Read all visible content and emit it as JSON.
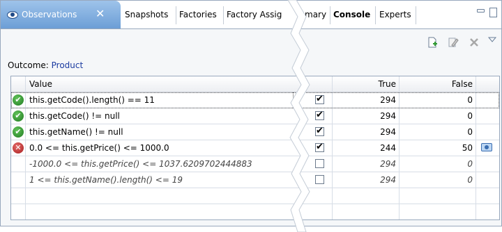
{
  "tabs": {
    "active": "Observations",
    "close": "✕",
    "left_tabs": [
      "Snapshots",
      "Factories",
      "Factory Assig"
    ],
    "right_tabs": [
      "mary",
      "Console",
      "Experts"
    ]
  },
  "outcome": {
    "label": "Outcome:",
    "value": "Product"
  },
  "table": {
    "headers": {
      "value": "Value",
      "true": "True",
      "false": "False"
    },
    "rows": [
      {
        "status": "pass",
        "value": "this.getCode().length() == 11",
        "checked": true,
        "true": "294",
        "false": "0",
        "italic": false
      },
      {
        "status": "pass",
        "value": "this.getCode() != null",
        "checked": true,
        "true": "294",
        "false": "0",
        "italic": false
      },
      {
        "status": "pass",
        "value": "this.getName() != null",
        "checked": true,
        "true": "294",
        "false": "0",
        "italic": false
      },
      {
        "status": "fail",
        "value": "0.0 <= this.getPrice() <= 1000.0",
        "checked": true,
        "true": "244",
        "false": "50",
        "italic": false,
        "snapshot": true
      },
      {
        "status": "none",
        "value": "-1000.0 <= this.getPrice() <= 1037.6209702444883",
        "checked": false,
        "true": "294",
        "false": "0",
        "italic": true
      },
      {
        "status": "none",
        "value": "1 <= this.getName().length() <= 19",
        "checked": false,
        "true": "294",
        "false": "0",
        "italic": true
      }
    ]
  },
  "icons": {
    "tab": "eye-icon",
    "toolbar": [
      "new-document-icon",
      "edit-icon",
      "delete-icon",
      "view-menu-icon"
    ],
    "pass": "check-circle-icon",
    "fail": "x-circle-icon",
    "snapshot": "camera-icon"
  },
  "colors": {
    "tab_active": "#6c9ed6",
    "link": "#1a3aa0",
    "pass": "#2e8b2e",
    "fail": "#b22222"
  }
}
